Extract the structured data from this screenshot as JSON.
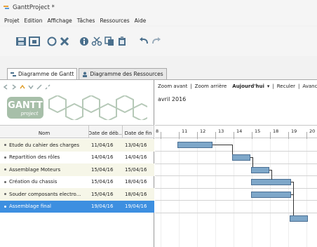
{
  "window": {
    "title": "GanttProject *"
  },
  "menu": [
    "Projet",
    "Edition",
    "Affichage",
    "Tâches",
    "Ressources",
    "Aide"
  ],
  "tabs": [
    {
      "label": "Diagramme de Gantt",
      "active": true
    },
    {
      "label": "Diagramme des Ressources",
      "active": false
    }
  ],
  "logo": {
    "main": "GANTT",
    "sub": "project"
  },
  "table": {
    "columns": [
      "Nom",
      "Date de déb...",
      "Date de fin"
    ],
    "rows": [
      {
        "name": "Etude du cahier des charges",
        "start": "11/04/16",
        "end": "13/04/16",
        "selected": false
      },
      {
        "name": "Repartition des rôles",
        "start": "14/04/16",
        "end": "14/04/16",
        "selected": false
      },
      {
        "name": "Assemblage Moteurs",
        "start": "15/04/16",
        "end": "15/04/16",
        "selected": false
      },
      {
        "name": "Création du chassis",
        "start": "15/04/16",
        "end": "18/04/16",
        "selected": false
      },
      {
        "name": "Souder composants electro...",
        "start": "15/04/16",
        "end": "18/04/16",
        "selected": false
      },
      {
        "name": "Assemblage final",
        "start": "19/04/16",
        "end": "19/04/16",
        "selected": true
      }
    ]
  },
  "gantt": {
    "zoom_in": "Zoom avant",
    "zoom_out": "Zoom arrière",
    "today": "Aujourd'hui",
    "back": "Reculer",
    "forward": "Avanc",
    "month": "avril 2016",
    "day_labels": [
      "8",
      "11",
      "12",
      "13",
      "14",
      "15",
      "18",
      "19",
      "20"
    ]
  },
  "colors": {
    "bar": "#7ea7c9",
    "selection": "#3d8fe0",
    "logo": "#9fb8a2"
  }
}
